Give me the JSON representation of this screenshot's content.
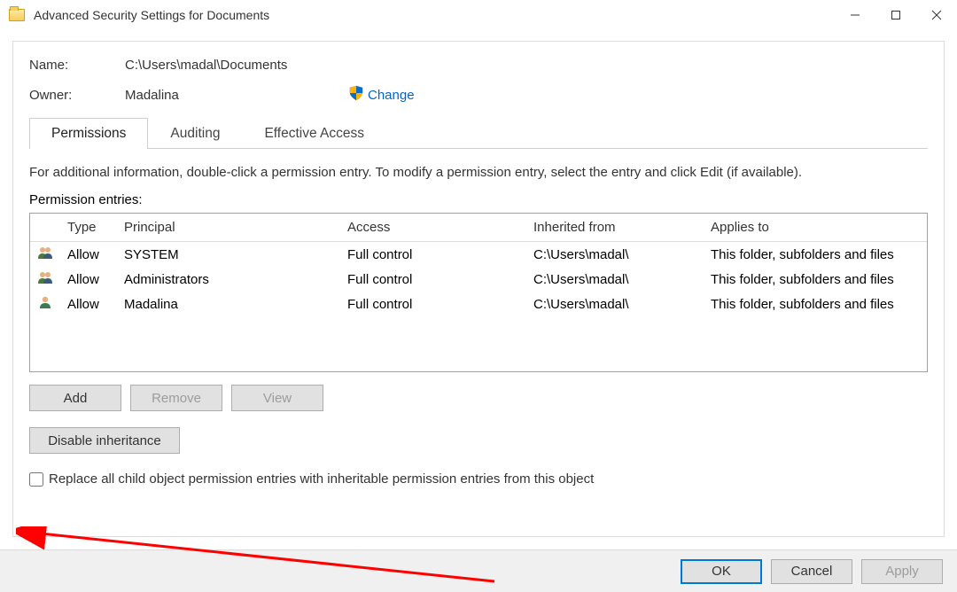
{
  "window": {
    "title": "Advanced Security Settings for Documents"
  },
  "info": {
    "name_label": "Name:",
    "name_value": "C:\\Users\\madal\\Documents",
    "owner_label": "Owner:",
    "owner_value": "Madalina",
    "change_label": "Change"
  },
  "tabs": {
    "permissions": "Permissions",
    "auditing": "Auditing",
    "effective": "Effective Access"
  },
  "instructions": "For additional information, double-click a permission entry. To modify a permission entry, select the entry and click Edit (if available).",
  "entries_label": "Permission entries:",
  "grid": {
    "headers": {
      "type": "Type",
      "principal": "Principal",
      "access": "Access",
      "inherited": "Inherited from",
      "applies": "Applies to"
    },
    "rows": [
      {
        "type": "Allow",
        "principal": "SYSTEM",
        "access": "Full control",
        "inherited": "C:\\Users\\madal\\",
        "applies": "This folder, subfolders and files"
      },
      {
        "type": "Allow",
        "principal": "Administrators",
        "access": "Full control",
        "inherited": "C:\\Users\\madal\\",
        "applies": "This folder, subfolders and files"
      },
      {
        "type": "Allow",
        "principal": "Madalina",
        "access": "Full control",
        "inherited": "C:\\Users\\madal\\",
        "applies": "This folder, subfolders and files"
      }
    ]
  },
  "buttons": {
    "add": "Add",
    "remove": "Remove",
    "view": "View",
    "disable_inheritance": "Disable inheritance",
    "ok": "OK",
    "cancel": "Cancel",
    "apply": "Apply"
  },
  "checkbox_label": "Replace all child object permission entries with inheritable permission entries from this object"
}
